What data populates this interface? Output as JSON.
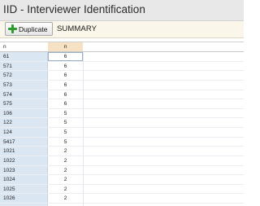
{
  "window": {
    "title": "IID - Interviewer Identification"
  },
  "toolbar": {
    "duplicate_label": "Duplicate",
    "tab_label": "SUMMARY"
  },
  "grid": {
    "columns": [
      "n",
      "n"
    ],
    "rows": [
      [
        "61",
        "6"
      ],
      [
        "571",
        "6"
      ],
      [
        "572",
        "6"
      ],
      [
        "573",
        "6"
      ],
      [
        "574",
        "6"
      ],
      [
        "575",
        "6"
      ],
      [
        "106",
        "5"
      ],
      [
        "122",
        "5"
      ],
      [
        "124",
        "5"
      ],
      [
        "5417",
        "5"
      ],
      [
        "1021",
        "2"
      ],
      [
        "1022",
        "2"
      ],
      [
        "1023",
        "2"
      ],
      [
        "1024",
        "2"
      ],
      [
        "1025",
        "2"
      ],
      [
        "1026",
        "2"
      ]
    ]
  },
  "colors": {
    "accent": "#f6e2c2",
    "row_header": "#dbe6f3",
    "plus_icon": "#2e9b2e"
  }
}
